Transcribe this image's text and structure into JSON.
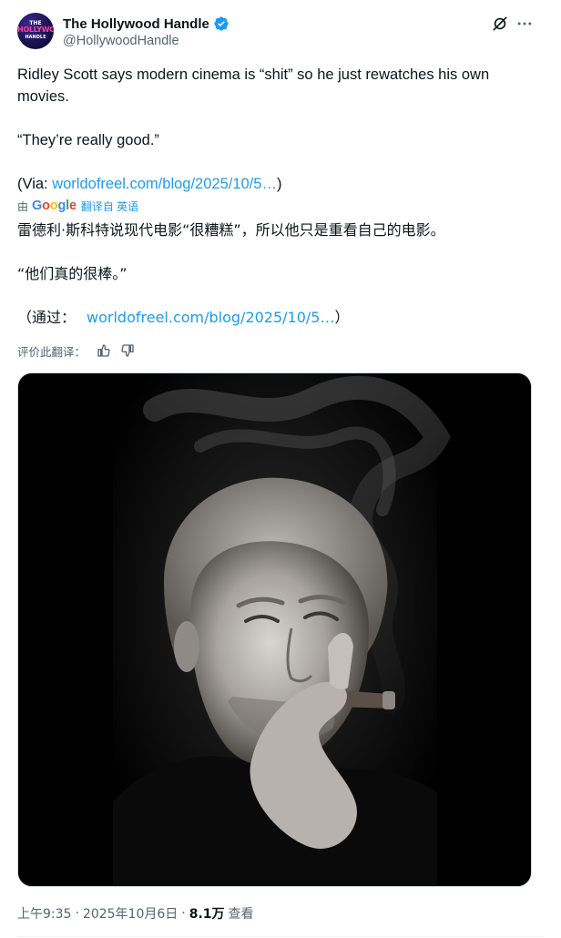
{
  "author": {
    "display_name": "The Hollywood Handle",
    "handle": "@HollywoodHandle",
    "avatar_logo": [
      "THE",
      "HOLLYWOOD",
      "HANDLE"
    ],
    "verified": true,
    "verified_color": "#1d9bf0"
  },
  "header_actions": {
    "grok_icon": "grok-icon",
    "more_icon": "more-horizontal-icon"
  },
  "tweet": {
    "line1": "Ridley Scott says modern cinema is “shit” so he just rewatches his own movies.",
    "line2": "“They’re really good.”",
    "via_prefix": "(Via: ",
    "via_link": "worldofreel.com/blog/2025/10/5…",
    "via_suffix": ")"
  },
  "translation": {
    "by_label": "由",
    "provider": [
      "G",
      "o",
      "o",
      "g",
      "l",
      "e"
    ],
    "source_label": "翻译自 英语",
    "line1": "雷德利·斯科特说现代电影“很糟糕”，所以他只是重看自己的电影。",
    "line2": "“他们真的很棒。”",
    "via_prefix": "（通过：",
    "via_link": "worldofreel.com/blog/2025/10/5…",
    "via_suffix": "）",
    "rate_label": "评价此翻译："
  },
  "media": {
    "description_icon": "photo"
  },
  "meta": {
    "time": "上午9:35",
    "separator": "·",
    "date": "2025年10月6日",
    "views_count": "8.1万",
    "views_label": "查看"
  },
  "colors": {
    "text": "#0f1419",
    "secondary": "#536471",
    "link": "#1d9bf0"
  }
}
